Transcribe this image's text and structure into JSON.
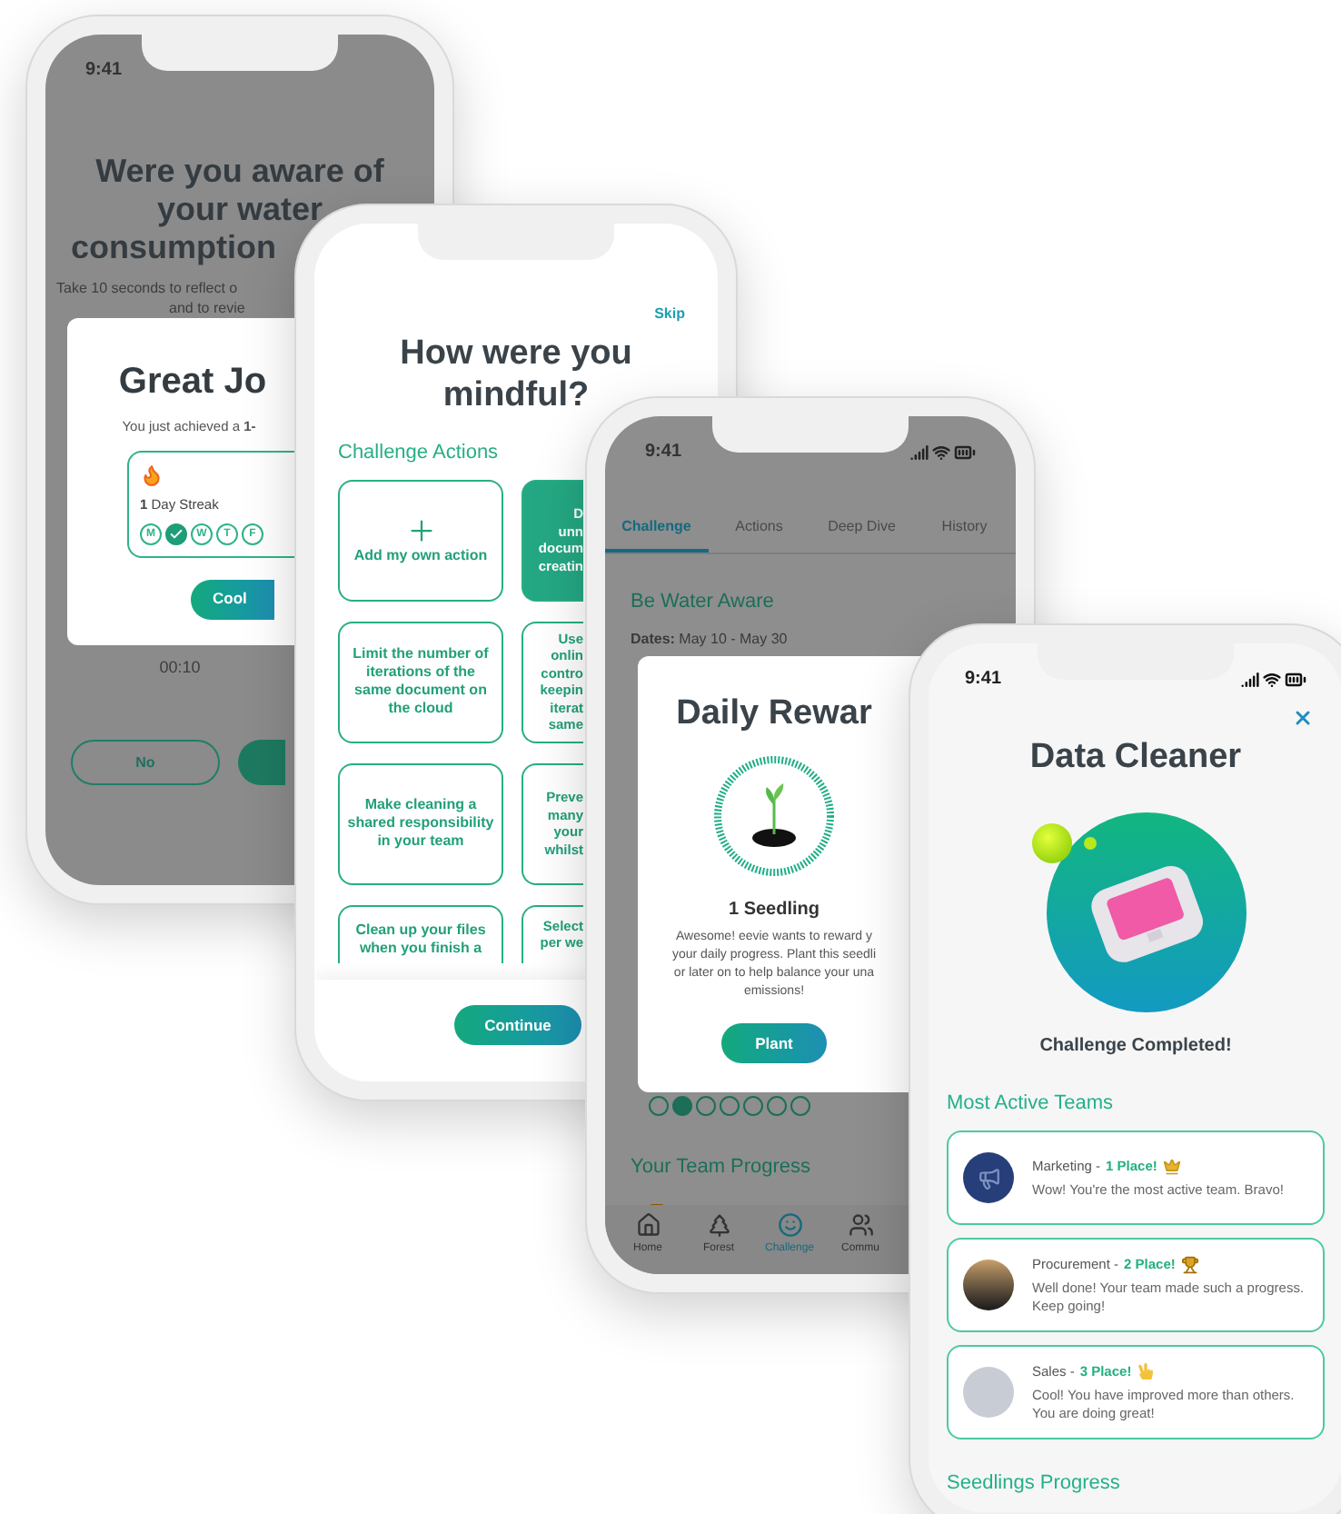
{
  "reflection_screen": {
    "status_time": "9:41",
    "title_lines": [
      "Were you aware of",
      "your water",
      "consumption"
    ],
    "subtitle_lines": [
      "Take 10 seconds to reflect o",
      "and to revie"
    ],
    "modal": {
      "title": "Great Jo",
      "message": "You just achieved a **1-**",
      "streak": "**1** Day Streak",
      "days": [
        {
          "label": "M",
          "done": false
        },
        {
          "done": true
        },
        {
          "label": "W",
          "done": false
        },
        {
          "label": "T",
          "done": false
        },
        {
          "label": "F",
          "done": false
        }
      ],
      "button": "Cool"
    },
    "timer": "00:10",
    "buttons": [
      "No"
    ]
  },
  "actions_screen": {
    "skip": "Skip",
    "title_lines": [
      "How were you",
      "mindful?"
    ],
    "section": "Challenge Actions",
    "cards": [
      {
        "kind": "add",
        "text": "Add my own action",
        "selected": false
      },
      {
        "kind": "action",
        "text": "Limit the number of iterations of the same document on the cloud",
        "selected": false
      },
      {
        "kind": "action",
        "text": "Make cleaning a shared responsibility in your team",
        "selected": false
      },
      {
        "kind": "action",
        "text": "Clean up your files when you finish a",
        "selected": false
      }
    ],
    "cut_cards": [
      {
        "lines": [
          "D",
          "unn",
          "docum",
          "creatin"
        ],
        "selected": true
      },
      {
        "lines": [
          "Use",
          "onlin",
          "contro",
          "keepin",
          "iterat",
          "same"
        ],
        "selected": false
      },
      {
        "lines": [
          "Preve",
          "many",
          "your",
          "whilst"
        ],
        "selected": false
      },
      {
        "lines": [
          "Select",
          "per we"
        ],
        "selected": false
      }
    ],
    "continue_button": "Continue"
  },
  "challenge_screen": {
    "status_time": "9:41",
    "tabs": [
      {
        "label": "Challenge",
        "selected": true
      },
      {
        "label": "Actions",
        "selected": false
      },
      {
        "label": "Deep Dive",
        "selected": false
      },
      {
        "label": "History",
        "selected": false
      }
    ],
    "challenge_title": "Be Water Aware",
    "dates": "**Dates:** May 10 - May 30",
    "modal": {
      "title": "Daily Rewar",
      "reward": "1 Seedling",
      "message_lines": [
        "Awesome! eevie wants to reward y",
        "your daily progress. Plant this seedli",
        "or later on to help balance your una",
        "emissions!"
      ],
      "button": "Plant"
    },
    "progress_days": [
      {
        "checked": false
      },
      {
        "checked": true
      },
      {
        "checked": false
      },
      {
        "checked": false
      },
      {
        "checked": false
      },
      {
        "checked": false
      },
      {
        "checked": false
      }
    ],
    "team_progress_title": "Your Team Progress",
    "nav": [
      {
        "label": "Home",
        "selected": false
      },
      {
        "label": "Forest",
        "selected": false
      },
      {
        "label": "Challenge",
        "selected": true
      },
      {
        "label": "Commu",
        "selected": false
      }
    ]
  },
  "completed_screen": {
    "status_time": "9:41",
    "title": "Data Cleaner",
    "status": "Challenge Completed!",
    "section": "Most Active Teams",
    "teams": [
      {
        "team": "Marketing -",
        "place": "1 Place!",
        "message": "Wow! You're the most active team. Bravo!"
      },
      {
        "team": "Procurement -",
        "place": "2 Place!",
        "message": "Well done! Your team made such a progress. Keep going!"
      },
      {
        "team": "Sales -",
        "place": "3 Place!",
        "message": "Cool! You have improved more than others. You are doing great!"
      }
    ],
    "next_section": "Seedlings Progress"
  }
}
